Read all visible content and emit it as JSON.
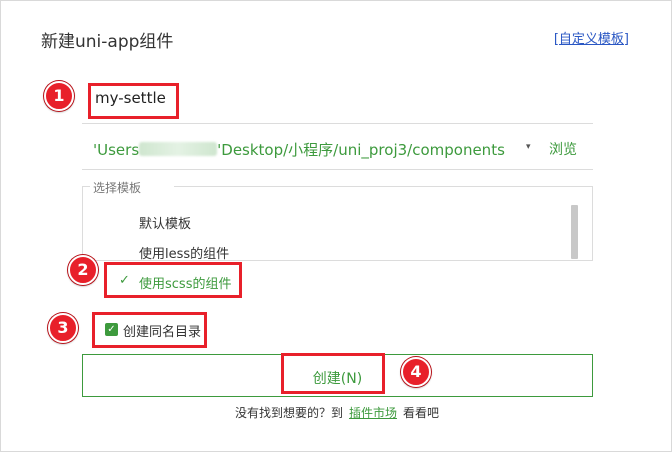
{
  "dialog": {
    "title": "新建uni-app组件",
    "custom_template_link": "[自定义模板]"
  },
  "name_input": {
    "value": "my-settle"
  },
  "path": {
    "prefix": "'Users",
    "suffix": "'Desktop/小程序/uni_proj3/components",
    "dropdown_icon": "▾",
    "browse_label": "浏览"
  },
  "templates": {
    "legend": "选择模板",
    "items": [
      {
        "label": "默认模板",
        "selected": false
      },
      {
        "label": "使用less的组件",
        "selected": false
      },
      {
        "label": "使用scss的组件",
        "selected": true
      }
    ]
  },
  "options": {
    "create_same_dir_label": "创建同名目录",
    "create_same_dir_checked": true
  },
  "actions": {
    "create_label": "创建(N)"
  },
  "footer": {
    "prefix": "没有找到想要的？到",
    "link": "插件市场",
    "suffix": "看看吧"
  },
  "annotations": {
    "badges": [
      "1",
      "2",
      "3",
      "4"
    ],
    "color": "#e8202a"
  },
  "colors": {
    "accent": "#3d9a3d",
    "link": "#2a57c4",
    "annotation": "#e8202a"
  }
}
